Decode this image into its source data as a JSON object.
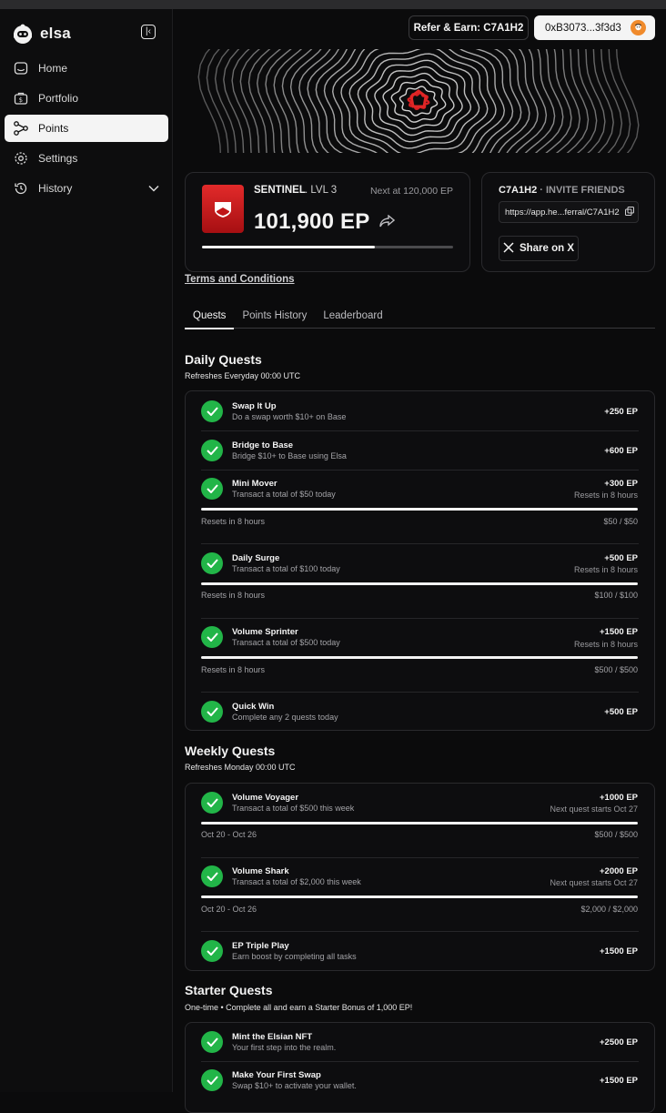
{
  "brand": {
    "name": "elsa"
  },
  "sidebar": {
    "items": [
      {
        "label": "Home",
        "icon": "home-icon",
        "active": false
      },
      {
        "label": "Portfolio",
        "icon": "portfolio-icon",
        "active": false
      },
      {
        "label": "Points",
        "icon": "points-icon",
        "active": true
      },
      {
        "label": "Settings",
        "icon": "gear-icon",
        "active": false
      },
      {
        "label": "History",
        "icon": "history-icon",
        "active": false
      }
    ]
  },
  "header": {
    "refer_label": "Refer & Earn: C7A1H2",
    "wallet_label": "0xB3073...3f3d3"
  },
  "rank": {
    "name": "SENTINEL",
    "level": ". LVL 3",
    "next": "Next at 120,000 EP",
    "total": "101,900 EP",
    "progress_fraction": 0.69
  },
  "invite": {
    "code": "C7A1H2",
    "title_suffix": " · INVITE FRIENDS",
    "link": "https://app.he...ferral/C7A1H2",
    "share_label": "Share on X"
  },
  "terms_label": "Terms and Conditions",
  "tabs": [
    {
      "label": "Quests",
      "active": true
    },
    {
      "label": "Points History",
      "active": false
    },
    {
      "label": "Leaderboard",
      "active": false
    }
  ],
  "daily": {
    "title": "Daily Quests",
    "subtitle": "Refreshes Everyday 00:00 UTC",
    "quests": [
      {
        "name": "Swap It Up",
        "desc": "Do a swap worth $10+ on Base",
        "ep": "+250 EP"
      },
      {
        "name": "Bridge to Base",
        "desc": "Bridge $10+ to Base using Elsa",
        "ep": "+600 EP"
      },
      {
        "name": "Mini Mover",
        "desc": "Transact a total of $50 today",
        "ep": "+300 EP",
        "reset": "Resets in 8 hours",
        "foot_left": "Resets in 8 hours",
        "foot_right": "$50 / $50",
        "progress_fraction": 1.0
      },
      {
        "name": "Daily Surge",
        "desc": "Transact a total of $100 today",
        "ep": "+500 EP",
        "reset": "Resets in 8 hours",
        "foot_left": "Resets in 8 hours",
        "foot_right": "$100 / $100",
        "progress_fraction": 1.0
      },
      {
        "name": "Volume Sprinter",
        "desc": "Transact a total of $500 today",
        "ep": "+1500 EP",
        "reset": "Resets in 8 hours",
        "foot_left": "Resets in 8 hours",
        "foot_right": "$500 / $500",
        "progress_fraction": 1.0
      },
      {
        "name": "Quick Win",
        "desc": "Complete any 2 quests today",
        "ep": "+500 EP"
      }
    ]
  },
  "weekly": {
    "title": "Weekly Quests",
    "subtitle": "Refreshes Monday 00:00 UTC",
    "quests": [
      {
        "name": "Volume Voyager",
        "desc": "Transact a total of $500 this week",
        "ep": "+1000 EP",
        "reset": "Next quest starts Oct 27",
        "foot_left": "Oct 20 - Oct 26",
        "foot_right": "$500 / $500",
        "progress_fraction": 1.0
      },
      {
        "name": "Volume Shark",
        "desc": "Transact a total of $2,000 this week",
        "ep": "+2000 EP",
        "reset": "Next quest starts Oct 27",
        "foot_left": "Oct 20 - Oct 26",
        "foot_right": "$2,000 / $2,000",
        "progress_fraction": 1.0
      },
      {
        "name": "EP Triple Play",
        "desc": "Earn boost by completing all tasks",
        "ep": "+1500 EP"
      }
    ]
  },
  "starter": {
    "title": "Starter Quests",
    "subtitle": "One-time • Complete all and earn a Starter Bonus of 1,000 EP!",
    "quests": [
      {
        "name": "Mint the Elsian NFT",
        "desc": "Your first step into the realm.",
        "ep": "+2500 EP"
      },
      {
        "name": "Make Your First Swap",
        "desc": "Swap $10+ to activate your wallet.",
        "ep": "+1500 EP"
      }
    ]
  },
  "colors": {
    "check_green": "#22b548",
    "rank_red": "#d81f22",
    "accent_orange": "#f08a2b"
  }
}
